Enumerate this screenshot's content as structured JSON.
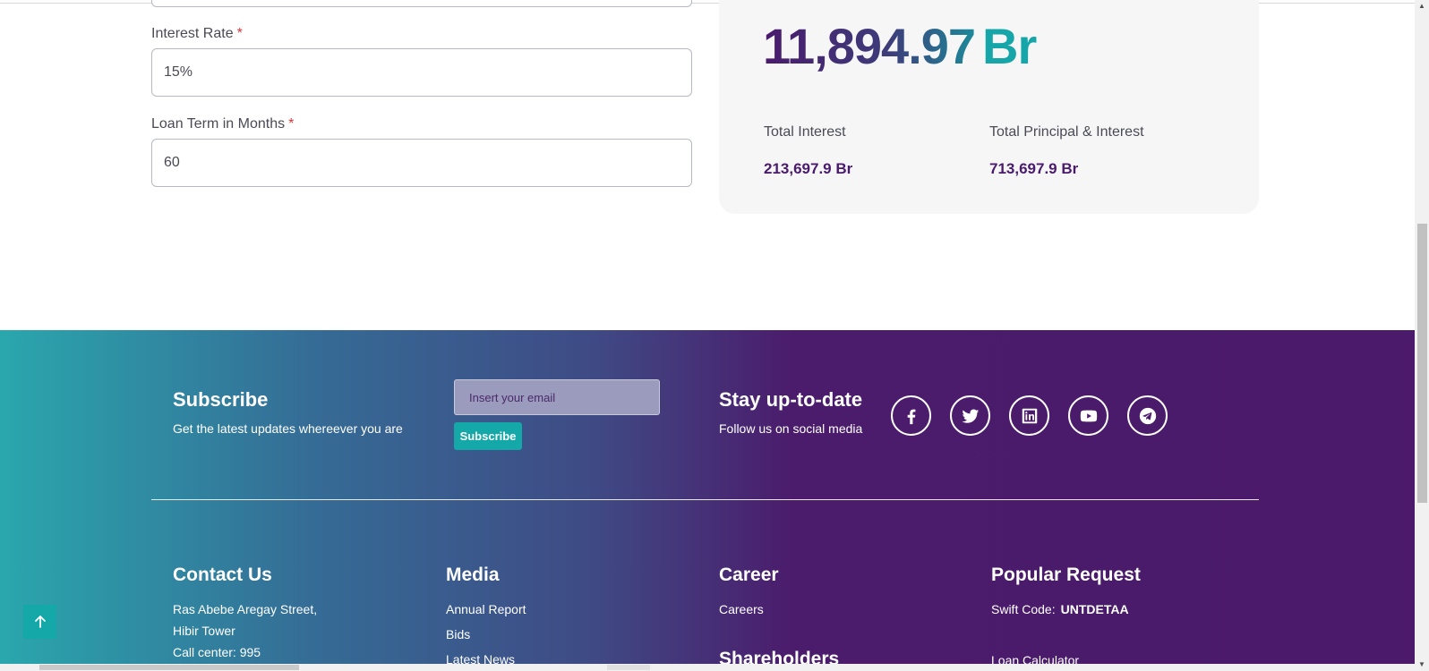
{
  "form": {
    "interest_rate": {
      "label": "Interest Rate",
      "required_mark": "*",
      "value": "15%"
    },
    "loan_term": {
      "label": "Loan Term in Months",
      "required_mark": "*",
      "value": "60"
    }
  },
  "result": {
    "monthly_amount": "11,894.97",
    "currency": "Br",
    "total_interest_label": "Total Interest",
    "total_interest_value": "213,697.9 Br",
    "total_pi_label": "Total Principal & Interest",
    "total_pi_value": "713,697.9 Br"
  },
  "footer": {
    "subscribe": {
      "title": "Subscribe",
      "subtitle": "Get the latest updates whereever you are",
      "email_placeholder": "Insert your email",
      "button": "Subscribe"
    },
    "social": {
      "title": "Stay up-to-date",
      "subtitle": "Follow us on social media",
      "icons": [
        "facebook-icon",
        "twitter-icon",
        "linkedin-icon",
        "youtube-icon",
        "telegram-icon"
      ]
    },
    "contact": {
      "title": "Contact Us",
      "lines": [
        "Ras Abebe Aregay Street,",
        "Hibir Tower",
        "Call center: 995"
      ]
    },
    "media": {
      "title": "Media",
      "links": [
        "Annual Report",
        "Bids",
        "Latest News"
      ]
    },
    "career": {
      "title": "Career",
      "links": [
        "Careers"
      ],
      "shareholders_title": "Shareholders"
    },
    "popular": {
      "title": "Popular Request",
      "swift_label": "Swift Code:",
      "swift_code": "UNTDETAA",
      "loan_calculator": "Loan Calculator"
    }
  },
  "colors": {
    "brand_purple": "#4b1a6a",
    "brand_teal": "#14a8a8"
  }
}
